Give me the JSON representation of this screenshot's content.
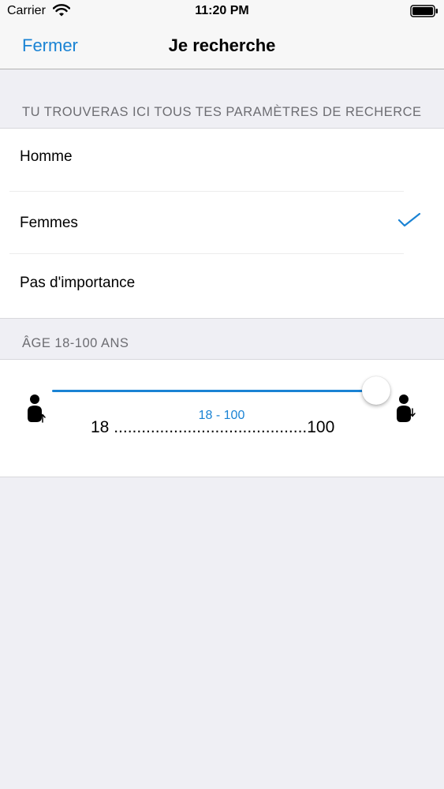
{
  "status_bar": {
    "carrier": "Carrier",
    "time": "11:20 PM",
    "wifi_icon": "wifi-icon",
    "battery_icon": "battery-icon"
  },
  "nav": {
    "close_label": "Fermer",
    "title": "Je recherche"
  },
  "search_section": {
    "header": "TU TROUVERAS ICI TOUS TES PARAMÈTRES DE RECHERCE",
    "options": [
      {
        "label": "Homme",
        "selected": false
      },
      {
        "label": "Femmes",
        "selected": true
      },
      {
        "label": "Pas d'importance",
        "selected": false
      }
    ],
    "check_icon": "checkmark-icon"
  },
  "age_section": {
    "header": "ÂGE 18-100 ANS",
    "slider": {
      "min": 18,
      "max": 100,
      "value": 100,
      "value_label": "18 - 100",
      "scale_text": "18 ..........................................100",
      "left_icon": "person-age-up-icon",
      "right_icon": "person-age-down-icon"
    }
  },
  "colors": {
    "accent": "#1a83d4",
    "background": "#efeff4",
    "section_header_text": "#6d6d72"
  }
}
